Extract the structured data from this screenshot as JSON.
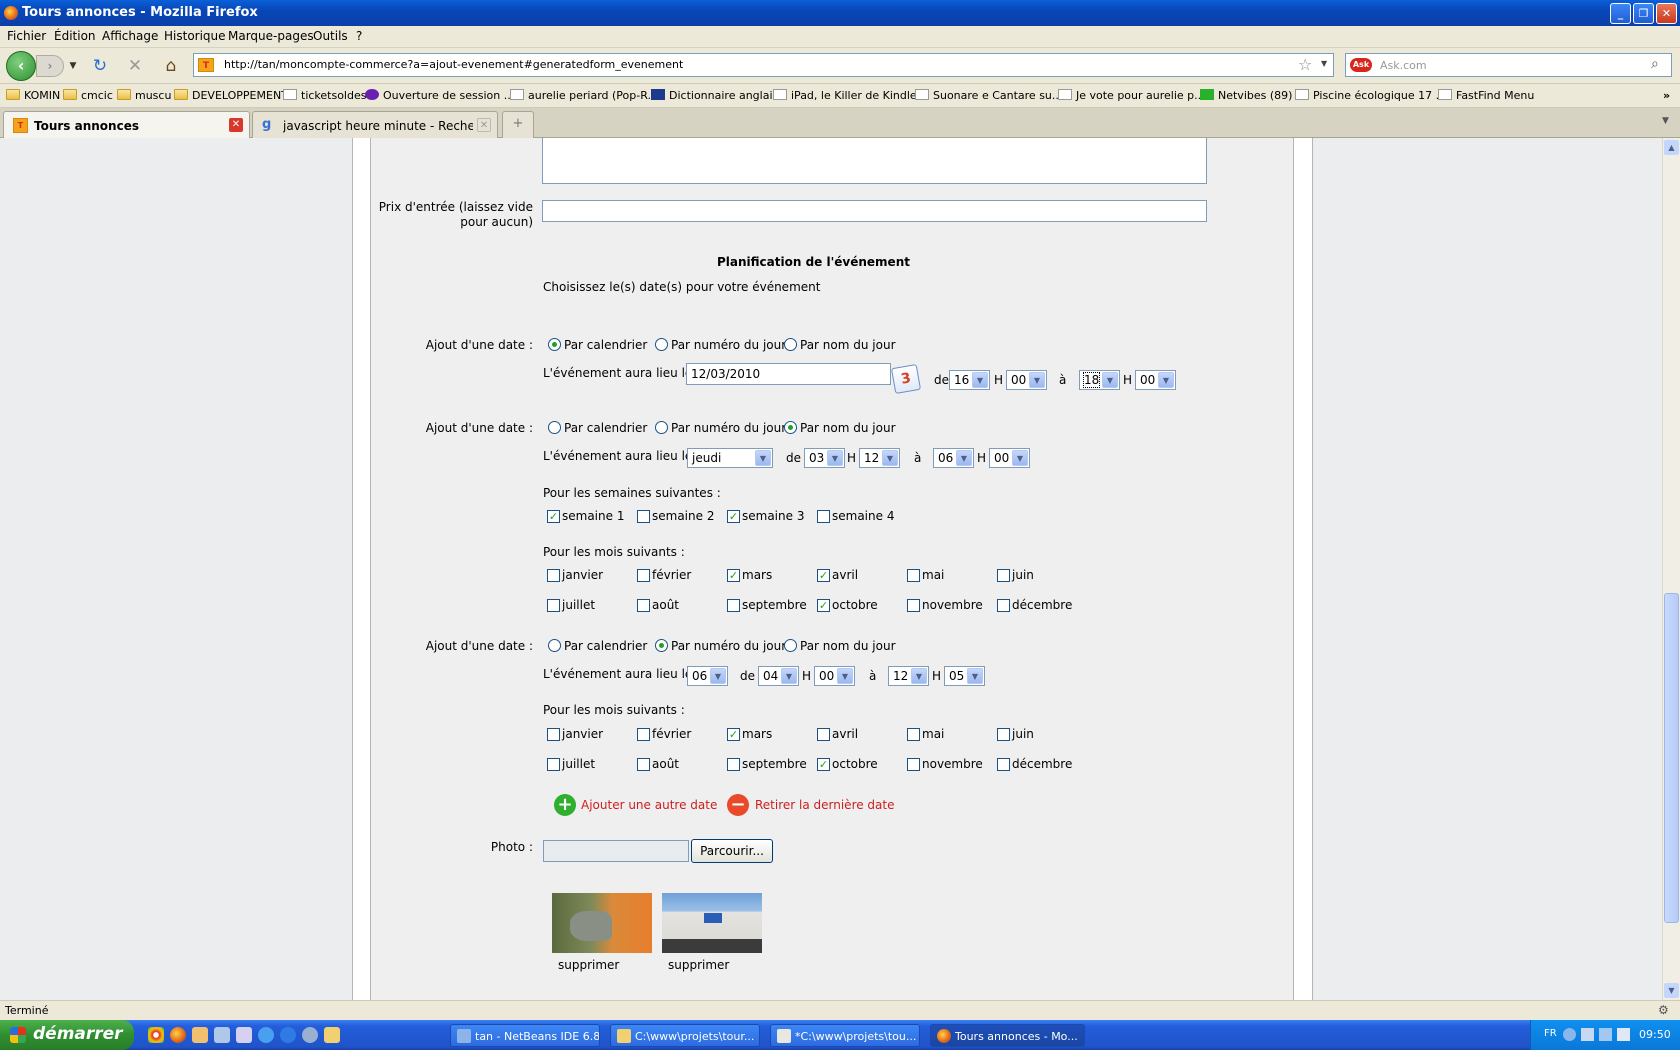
{
  "window": {
    "title": "Tours annonces - Mozilla Firefox"
  },
  "menu": [
    "Fichier",
    "Édition",
    "Affichage",
    "Historique",
    "Marque-pages",
    "Outils",
    "?"
  ],
  "nav": {
    "url": "http://tan/moncompte-commerce?a=ajout-evenement#generatedform_evenement",
    "search_placeholder": "Ask.com"
  },
  "bookmarks": [
    "KOMIN",
    "cmcic",
    "muscu",
    "DEVELOPPEMENT",
    "ticketsoldes",
    "Ouverture de session ...",
    "aurelie periard (Pop-R...",
    "Dictionnaire anglais",
    "iPad, le Killer de Kindle...",
    "Suonare e Cantare su...",
    "Je vote pour aurelie p...",
    "Netvibes (89)",
    "Piscine écologique 17 ...",
    "FastFind Menu"
  ],
  "tabs": [
    {
      "label": "Tours annonces"
    },
    {
      "label": "javascript heure minute - Recherche G..."
    }
  ],
  "form": {
    "prix_label_1": "Prix d'entrée (laissez vide",
    "prix_label_2": "pour aucun)",
    "section_title": "Planification de l'événement",
    "section_subtitle": "Choisissez le(s) date(s) pour votre événement",
    "ajout_label": "Ajout d'une date :",
    "radio_cal": "Par calendrier",
    "radio_num": "Par numéro du jour",
    "radio_nom": "Par nom du jour",
    "lieu_label": "L'événement aura lieu le",
    "de": "de",
    "h": "H",
    "a": "à",
    "semaines_label": "Pour les semaines suivantes :",
    "mois_label": "Pour les mois suivants :",
    "d1": {
      "date": "12/03/2010",
      "h1": "16",
      "m1": "00",
      "h2": "18",
      "m2": "00",
      "cal_icon": "3"
    },
    "d2": {
      "day": "jeudi",
      "h1": "03",
      "m1": "12",
      "h2": "06",
      "m2": "00",
      "weeks": [
        "semaine 1",
        "semaine 2",
        "semaine 3",
        "semaine 4"
      ],
      "weeks_checked": [
        true,
        false,
        true,
        false
      ]
    },
    "months": [
      "janvier",
      "février",
      "mars",
      "avril",
      "mai",
      "juin",
      "juillet",
      "août",
      "septembre",
      "octobre",
      "novembre",
      "décembre"
    ],
    "d2_months_checked": [
      false,
      false,
      true,
      true,
      false,
      false,
      false,
      false,
      false,
      true,
      false,
      false
    ],
    "d3": {
      "daynum": "06",
      "h1": "04",
      "m1": "00",
      "h2": "12",
      "m2": "05"
    },
    "d3_months_checked": [
      false,
      false,
      true,
      false,
      false,
      false,
      false,
      false,
      false,
      true,
      false,
      false
    ],
    "add_date": "Ajouter une autre date",
    "remove_date": "Retirer la dernière date",
    "photo_label": "Photo :",
    "browse": "Parcourir...",
    "delete": "supprimer"
  },
  "status": "Terminé",
  "taskbar": {
    "start": "démarrer",
    "tasks": [
      "tan - NetBeans IDE 6.8",
      "C:\\www\\projets\\tour...",
      "*C:\\www\\projets\\tou...",
      "Tours annonces - Mo..."
    ],
    "lang": "FR",
    "clock": "09:50"
  },
  "colors": {
    "accent": "#0a5fd8",
    "link_red": "#cc1f1f",
    "check_green": "#21a121"
  }
}
